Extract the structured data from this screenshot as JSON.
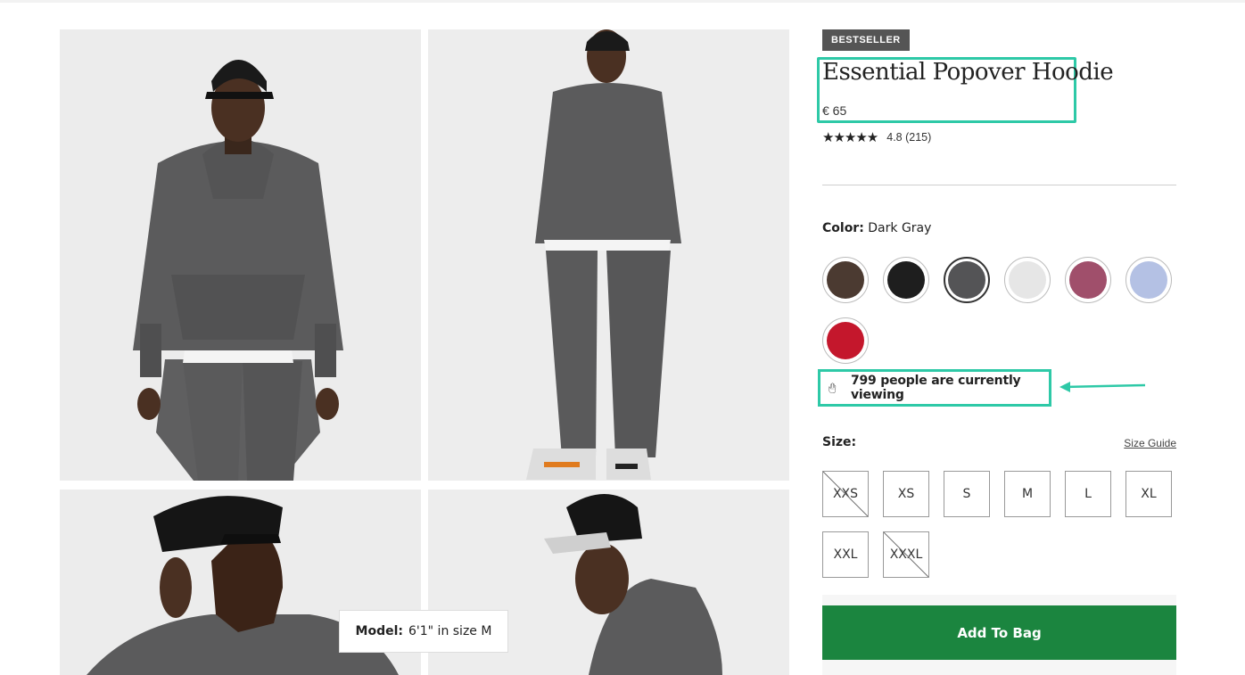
{
  "product": {
    "badge": "BESTSELLER",
    "title": "Essential Popover Hoodie",
    "price": "€ 65",
    "rating_value": 4.8,
    "rating_text": "4.8 (215)",
    "stars": "★★★★★"
  },
  "color": {
    "label": "Color:",
    "selected": "Dark Gray",
    "swatches": [
      {
        "name": "Brown",
        "hex": "#4b3a31"
      },
      {
        "name": "Black",
        "hex": "#1e1e1e"
      },
      {
        "name": "Dark Gray",
        "hex": "#545456",
        "selected": true
      },
      {
        "name": "Light Gray",
        "hex": "#e6e6e6"
      },
      {
        "name": "Mauve",
        "hex": "#a04f6b"
      },
      {
        "name": "Lavender",
        "hex": "#b4c1e4"
      },
      {
        "name": "Red",
        "hex": "#c4172c"
      }
    ]
  },
  "viewing": {
    "icon": "hand-icon",
    "text": "799 people are currently viewing"
  },
  "size": {
    "label": "Size:",
    "guide_label": "Size Guide",
    "options": [
      {
        "label": "XXS",
        "available": false
      },
      {
        "label": "XS",
        "available": true
      },
      {
        "label": "S",
        "available": true
      },
      {
        "label": "M",
        "available": true
      },
      {
        "label": "L",
        "available": true
      },
      {
        "label": "XL",
        "available": true
      },
      {
        "label": "XXL",
        "available": true
      },
      {
        "label": "XXXL",
        "available": false
      }
    ]
  },
  "model": {
    "label": "Model:",
    "text": "6'1\" in size M"
  },
  "actions": {
    "add_to_bag": "Add To Bag"
  },
  "colors": {
    "highlight": "#2ec9a7",
    "cta": "#1b853f"
  }
}
